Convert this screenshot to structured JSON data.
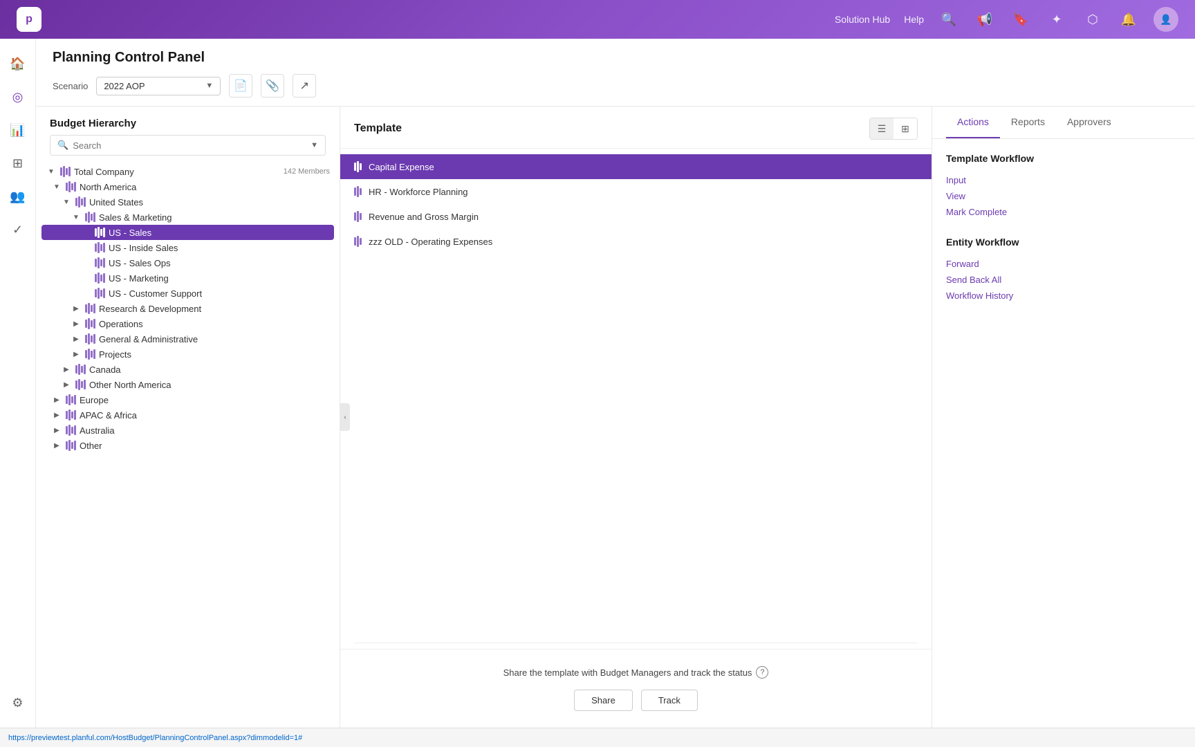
{
  "topNav": {
    "solutionHub": "Solution Hub",
    "help": "Help",
    "logo": "p"
  },
  "pageHeader": {
    "title": "Planning Control Panel",
    "scenarioLabel": "Scenario",
    "scenarioValue": "2022 AOP"
  },
  "budgetPanel": {
    "title": "Budget Hierarchy",
    "searchPlaceholder": "Search",
    "tree": [
      {
        "id": "total-company",
        "label": "Total Company",
        "badge": "142 Members",
        "indent": 0,
        "expanded": true,
        "hasToggle": true
      },
      {
        "id": "north-america",
        "label": "North America",
        "indent": 1,
        "expanded": true,
        "hasToggle": true
      },
      {
        "id": "united-states",
        "label": "United States",
        "indent": 2,
        "expanded": true,
        "hasToggle": true
      },
      {
        "id": "sales-marketing",
        "label": "Sales & Marketing",
        "indent": 3,
        "expanded": true,
        "hasToggle": true
      },
      {
        "id": "us-sales",
        "label": "US - Sales",
        "indent": 4,
        "selected": true
      },
      {
        "id": "us-inside-sales",
        "label": "US - Inside Sales",
        "indent": 4
      },
      {
        "id": "us-sales-ops",
        "label": "US - Sales Ops",
        "indent": 4
      },
      {
        "id": "us-marketing",
        "label": "US - Marketing",
        "indent": 4
      },
      {
        "id": "us-customer-support",
        "label": "US - Customer Support",
        "indent": 4
      },
      {
        "id": "research-dev",
        "label": "Research & Development",
        "indent": 3,
        "hasToggle": true,
        "collapsed": true
      },
      {
        "id": "operations",
        "label": "Operations",
        "indent": 3,
        "hasToggle": true,
        "collapsed": true
      },
      {
        "id": "general-admin",
        "label": "General & Administrative",
        "indent": 3,
        "hasToggle": true,
        "collapsed": true
      },
      {
        "id": "projects",
        "label": "Projects",
        "indent": 3,
        "hasToggle": true,
        "collapsed": true
      },
      {
        "id": "canada",
        "label": "Canada",
        "indent": 2,
        "hasToggle": true,
        "collapsed": true
      },
      {
        "id": "other-north-america",
        "label": "Other North America",
        "indent": 2,
        "hasToggle": true,
        "collapsed": true
      },
      {
        "id": "europe",
        "label": "Europe",
        "indent": 1,
        "hasToggle": true,
        "collapsed": true
      },
      {
        "id": "apac-africa",
        "label": "APAC & Africa",
        "indent": 1,
        "hasToggle": true,
        "collapsed": true
      },
      {
        "id": "australia",
        "label": "Australia",
        "indent": 1,
        "hasToggle": true,
        "collapsed": true
      },
      {
        "id": "other",
        "label": "Other",
        "indent": 1,
        "hasToggle": true,
        "collapsed": true
      }
    ]
  },
  "templatePanel": {
    "title": "Template",
    "templates": [
      {
        "id": "capital-expense",
        "label": "Capital Expense",
        "active": true
      },
      {
        "id": "hr-workforce",
        "label": "HR - Workforce Planning"
      },
      {
        "id": "revenue-margin",
        "label": "Revenue and Gross Margin"
      },
      {
        "id": "zzz-old",
        "label": "zzz OLD - Operating Expenses"
      }
    ],
    "shareText": "Share the template with Budget Managers and track the status",
    "shareButton": "Share",
    "trackButton": "Track"
  },
  "rightPanel": {
    "tabs": [
      "Actions",
      "Reports",
      "Approvers"
    ],
    "activeTab": "Actions",
    "templateWorkflow": {
      "title": "Template Workflow",
      "links": [
        "Input",
        "View",
        "Mark Complete"
      ]
    },
    "entityWorkflow": {
      "title": "Entity Workflow",
      "links": [
        "Forward",
        "Send Back All",
        "Workflow History"
      ]
    }
  },
  "statusBar": {
    "url": "https://previewtest.planful.com/HostBudget/PlanningControlPanel.aspx?dimmodelid=1#"
  }
}
